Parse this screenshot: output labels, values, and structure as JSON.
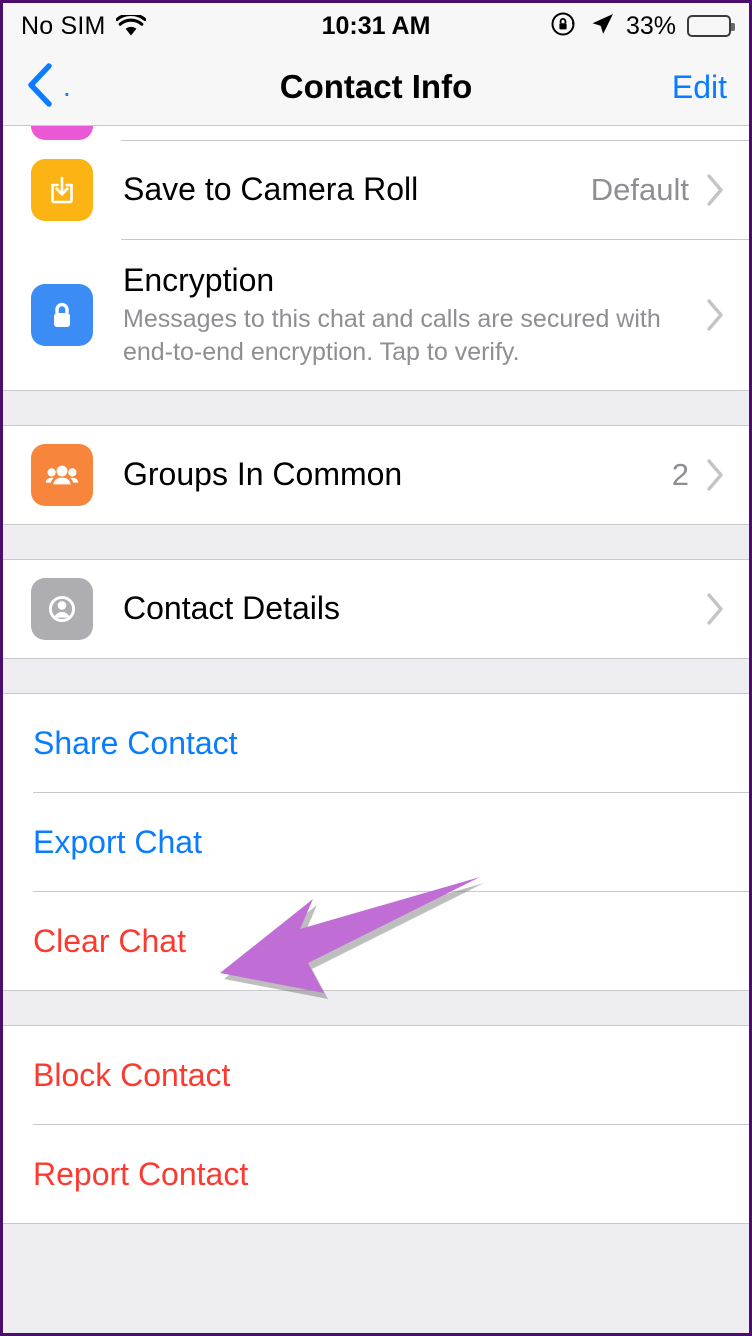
{
  "status_bar": {
    "carrier": "No SIM",
    "wifi_icon": "wifi-icon",
    "time": "10:31 AM",
    "rotation_lock_icon": "rotation-lock-icon",
    "location_icon": "location-arrow-icon",
    "battery_percent": "33%",
    "battery_level": 33
  },
  "nav_bar": {
    "back_icon": "chevron-left-icon",
    "back_label": ".",
    "title": "Contact Info",
    "edit_label": "Edit"
  },
  "colors": {
    "link_blue": "#0a7cff",
    "danger_red": "#fb3b30",
    "value_gray": "#8e8e93",
    "group_bg": "#eeedf2",
    "icon_amber": "#fcb415",
    "icon_blue": "#3b8cf5",
    "icon_orange": "#f7863c",
    "icon_gray": "#aeaeb2",
    "annotation_purple": "#c06ed6"
  },
  "sections": {
    "settings": {
      "save_to_camera_roll": {
        "icon": "save-download-icon",
        "title": "Save to Camera Roll",
        "value": "Default",
        "chevron": "chevron-right-icon"
      },
      "encryption": {
        "icon": "lock-icon",
        "title": "Encryption",
        "subtitle": "Messages to this chat and calls are secured with end-to-end encryption. Tap to verify.",
        "chevron": "chevron-right-icon"
      }
    },
    "groups": {
      "groups_in_common": {
        "icon": "group-people-icon",
        "title": "Groups In Common",
        "value": "2",
        "chevron": "chevron-right-icon"
      }
    },
    "details": {
      "contact_details": {
        "icon": "person-circle-icon",
        "title": "Contact Details",
        "chevron": "chevron-right-icon"
      }
    },
    "actions": {
      "share_contact": "Share Contact",
      "export_chat": "Export Chat",
      "clear_chat": "Clear Chat"
    },
    "destructive": {
      "block_contact": "Block Contact",
      "report_contact": "Report Contact"
    }
  },
  "annotation": {
    "arrow_icon": "annotation-arrow-icon",
    "points_to": "Clear Chat"
  }
}
